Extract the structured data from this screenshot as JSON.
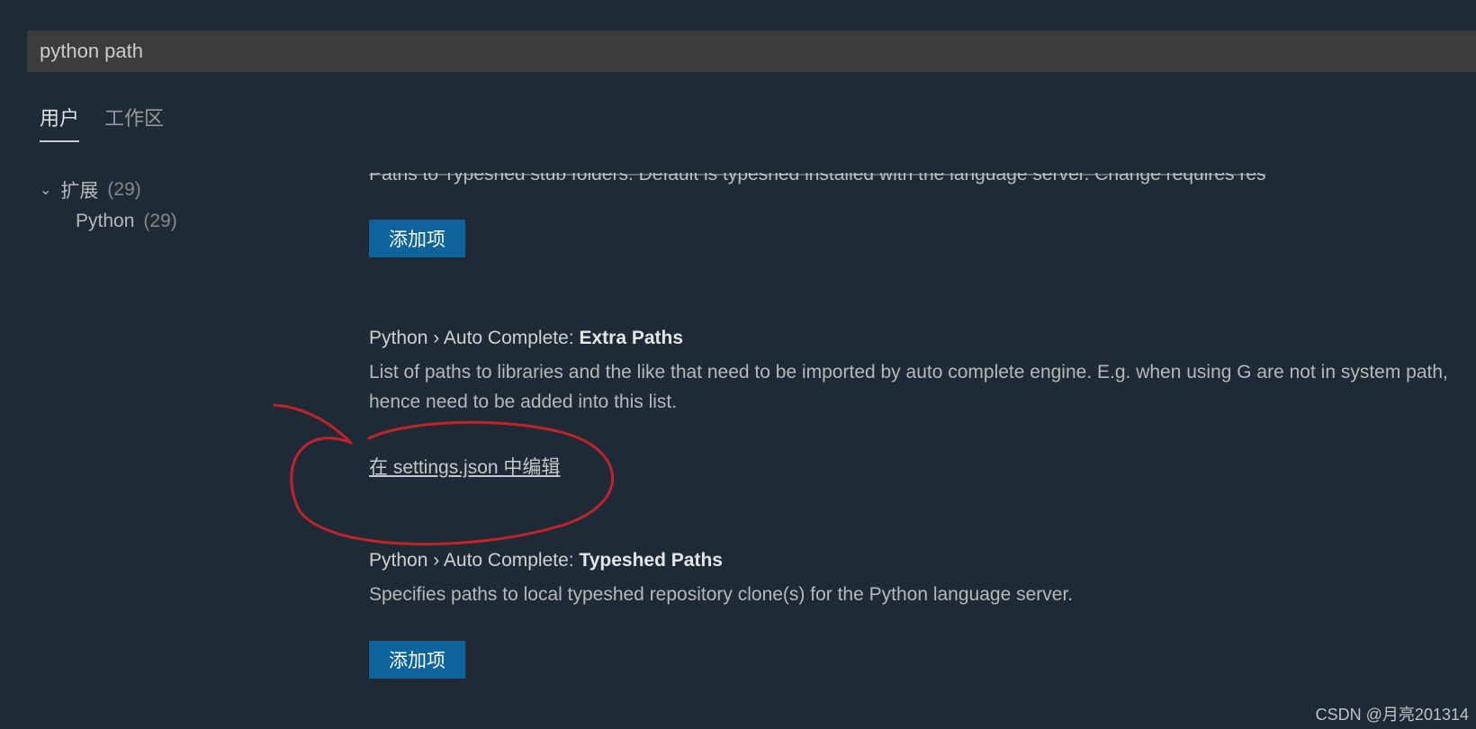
{
  "search": {
    "value": "python path"
  },
  "tabs": {
    "user": "用户",
    "workspace": "工作区"
  },
  "sidebar": {
    "group_label": "扩展",
    "group_count": "(29)",
    "item_label": "Python",
    "item_count": "(29)"
  },
  "top": {
    "truncated_desc": "Paths to Typeshed stub folders. Default is typeshed installed with the language server. Change requires res",
    "add_button": "添加项"
  },
  "setting1": {
    "prefix": "Python › Auto Complete: ",
    "name": "Extra Paths",
    "desc": "List of paths to libraries and the like that need to be imported by auto complete engine. E.g. when using G are not in system path, hence need to be added into this list.",
    "edit_link": "在 settings.json 中编辑"
  },
  "setting2": {
    "prefix": "Python › Auto Complete: ",
    "name": "Typeshed Paths",
    "desc": "Specifies paths to local typeshed repository clone(s) for the Python language server.",
    "add_button": "添加项"
  },
  "watermark": "CSDN @月亮201314"
}
